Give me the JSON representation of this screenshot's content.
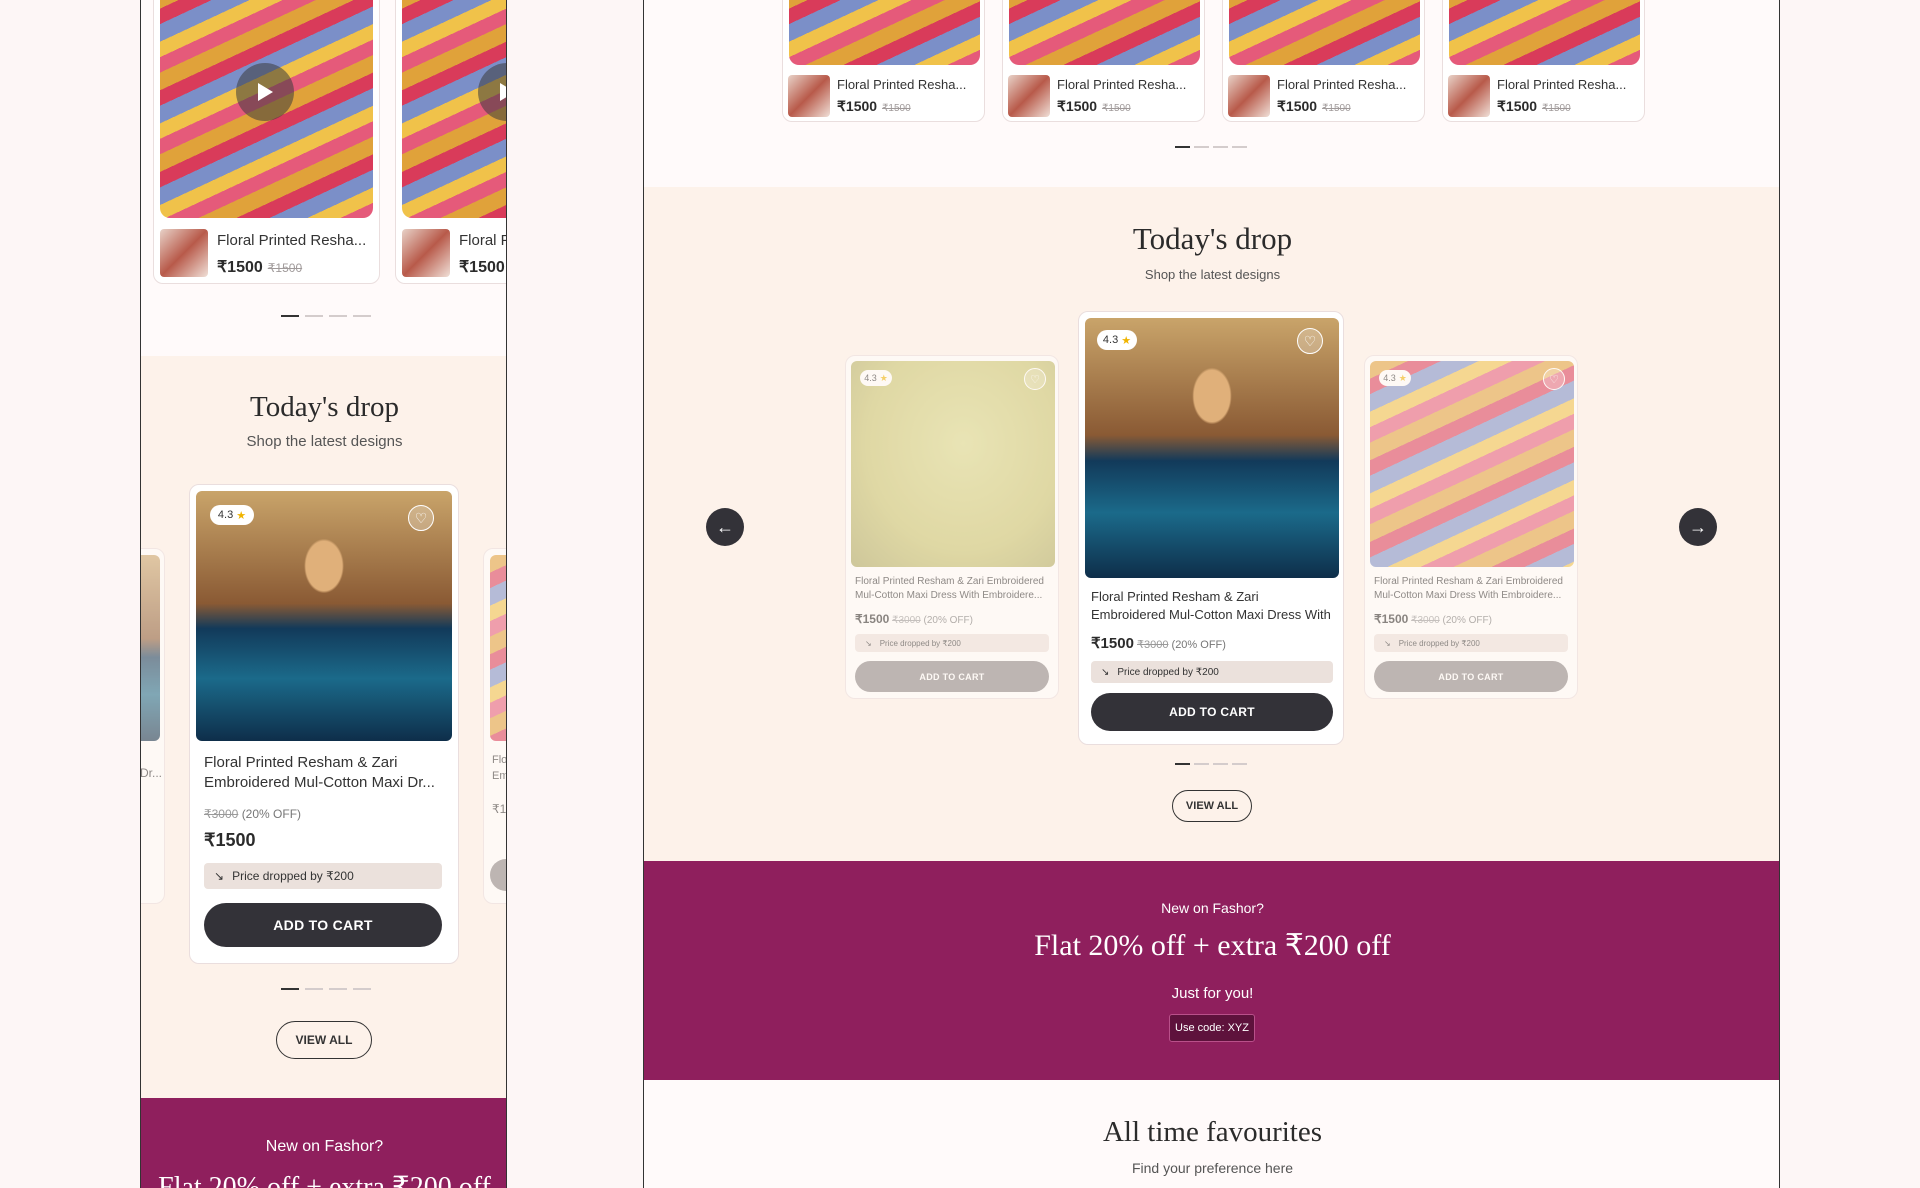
{
  "colors": {
    "promo": "#8f1f5d",
    "drop_bg": "#fdf2ea",
    "button_dark": "#333238"
  },
  "reel": {
    "title": "Floral Printed Resha...",
    "price": "₹1500",
    "old_price": "₹1500",
    "mobile_title_cut": "Floral F",
    "play_icon": "play-icon"
  },
  "drop": {
    "title": "Today's drop",
    "subtitle": "Shop the latest designs",
    "rating": "4.3",
    "name": "Floral Printed Resham & Zari Embroidered Mul-Cotton Maxi Dress With Embroidere...",
    "mobile_name": "Floral Printed Resham & Zari Embroidered Mul-Cotton Maxi Dr...",
    "price": "₹1500",
    "old_price": "₹3000",
    "discount": "(20% OFF)",
    "price_drop": "Price dropped by ₹200",
    "add_to_cart": "ADD TO CART",
    "view_all": "VIEW ALL",
    "side_snip_1": "Dr...",
    "side_snip_2": "Flo",
    "side_snip_3": "Em",
    "side_snip_4": "₹15"
  },
  "promo": {
    "eyebrow": "New on Fashor?",
    "headline": "Flat 20% off + extra ₹200 off",
    "tagline": "Just for you!",
    "code": "Use code: XYZ"
  },
  "favourites": {
    "title": "All time favourites",
    "subtitle": "Find your preference here"
  }
}
